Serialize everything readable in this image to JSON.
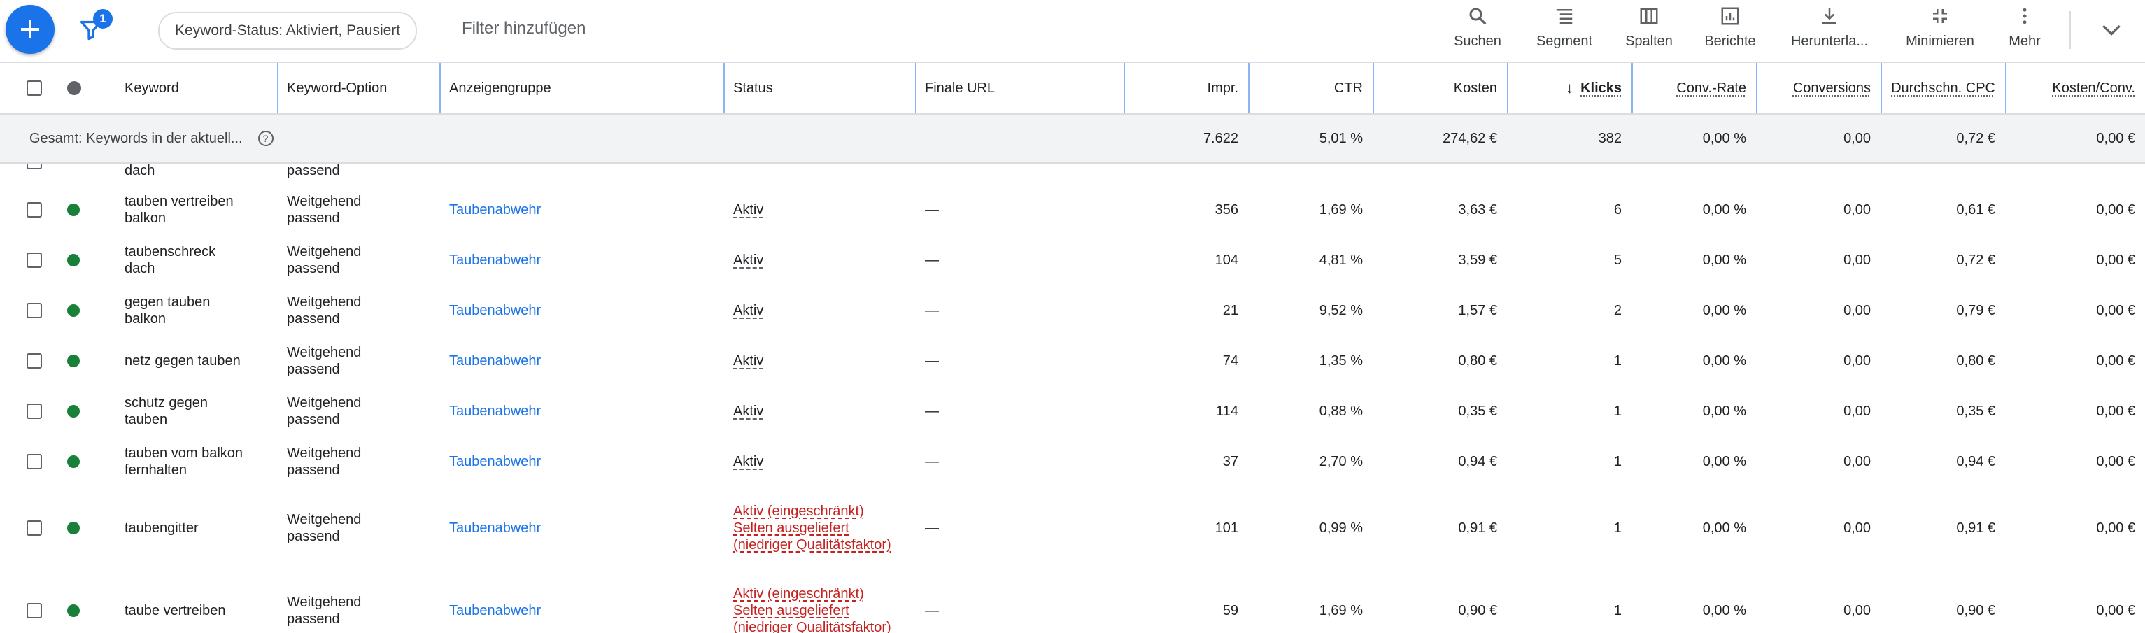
{
  "toolbar": {
    "filter_count": "1",
    "filter_chip": "Keyword-Status: Aktiviert, Pausiert",
    "add_filter": "Filter hinzufügen",
    "tools": [
      {
        "label": "Suchen",
        "icon": "search-icon"
      },
      {
        "label": "Segment",
        "icon": "segment-icon"
      },
      {
        "label": "Spalten",
        "icon": "columns-icon"
      },
      {
        "label": "Berichte",
        "icon": "reports-icon"
      },
      {
        "label": "Herunterla...",
        "icon": "download-icon"
      },
      {
        "label": "Minimieren",
        "icon": "collapse-icon"
      },
      {
        "label": "Mehr",
        "icon": "more-vert-icon"
      }
    ]
  },
  "table": {
    "headers": {
      "keyword": "Keyword",
      "option": "Keyword-Option",
      "adgroup": "Anzeigengruppe",
      "status": "Status",
      "url": "Finale URL",
      "impr": "Impr.",
      "ctr": "CTR",
      "cost": "Kosten",
      "clicks": "Klicks",
      "convrate": "Conv.-Rate",
      "conversions": "Conversions",
      "cpc": "Durchschn. CPC",
      "costconv": "Kosten/Conv."
    },
    "total": {
      "label": "Gesamt: Keywords in der aktuell...",
      "impr": "7.622",
      "ctr": "5,01 %",
      "cost": "274,62 €",
      "clicks": "382",
      "convrate": "0,00 %",
      "conversions": "0,00",
      "cpc": "0,72 €",
      "costconv": "0,00 €"
    },
    "partial_row": {
      "keyword": "dach",
      "option": "passend"
    },
    "rows": [
      {
        "keyword": [
          "tauben vertreiben",
          "balkon"
        ],
        "option": [
          "Weitgehend",
          "passend"
        ],
        "adgroup": "Taubenabwehr",
        "status": [
          "Aktiv"
        ],
        "url": "—",
        "impr": "356",
        "ctr": "1,69 %",
        "cost": "3,63 €",
        "clicks": "6",
        "convrate": "0,00 %",
        "conversions": "0,00",
        "cpc": "0,61 €",
        "costconv": "0,00 €"
      },
      {
        "keyword": [
          "taubenschreck",
          "dach"
        ],
        "option": [
          "Weitgehend",
          "passend"
        ],
        "adgroup": "Taubenabwehr",
        "status": [
          "Aktiv"
        ],
        "url": "—",
        "impr": "104",
        "ctr": "4,81 %",
        "cost": "3,59 €",
        "clicks": "5",
        "convrate": "0,00 %",
        "conversions": "0,00",
        "cpc": "0,72 €",
        "costconv": "0,00 €"
      },
      {
        "keyword": [
          "gegen tauben",
          "balkon"
        ],
        "option": [
          "Weitgehend",
          "passend"
        ],
        "adgroup": "Taubenabwehr",
        "status": [
          "Aktiv"
        ],
        "url": "—",
        "impr": "21",
        "ctr": "9,52 %",
        "cost": "1,57 €",
        "clicks": "2",
        "convrate": "0,00 %",
        "conversions": "0,00",
        "cpc": "0,79 €",
        "costconv": "0,00 €"
      },
      {
        "keyword": [
          "netz gegen tauben"
        ],
        "option": [
          "Weitgehend",
          "passend"
        ],
        "adgroup": "Taubenabwehr",
        "status": [
          "Aktiv"
        ],
        "url": "—",
        "impr": "74",
        "ctr": "1,35 %",
        "cost": "0,80 €",
        "clicks": "1",
        "convrate": "0,00 %",
        "conversions": "0,00",
        "cpc": "0,80 €",
        "costconv": "0,00 €"
      },
      {
        "keyword": [
          "schutz gegen",
          "tauben"
        ],
        "option": [
          "Weitgehend",
          "passend"
        ],
        "adgroup": "Taubenabwehr",
        "status": [
          "Aktiv"
        ],
        "url": "—",
        "impr": "114",
        "ctr": "0,88 %",
        "cost": "0,35 €",
        "clicks": "1",
        "convrate": "0,00 %",
        "conversions": "0,00",
        "cpc": "0,35 €",
        "costconv": "0,00 €"
      },
      {
        "keyword": [
          "tauben vom balkon",
          "fernhalten"
        ],
        "option": [
          "Weitgehend",
          "passend"
        ],
        "adgroup": "Taubenabwehr",
        "status": [
          "Aktiv"
        ],
        "url": "—",
        "impr": "37",
        "ctr": "2,70 %",
        "cost": "0,94 €",
        "clicks": "1",
        "convrate": "0,00 %",
        "conversions": "0,00",
        "cpc": "0,94 €",
        "costconv": "0,00 €"
      },
      {
        "keyword": [
          "taubengitter"
        ],
        "option": [
          "Weitgehend",
          "passend"
        ],
        "adgroup": "Taubenabwehr",
        "status": [
          "Aktiv (eingeschränkt)",
          "Selten ausgeliefert",
          "(niedriger Qualitätsfaktor)"
        ],
        "url": "—",
        "impr": "101",
        "ctr": "0,99 %",
        "cost": "0,91 €",
        "clicks": "1",
        "convrate": "0,00 %",
        "conversions": "0,00",
        "cpc": "0,91 €",
        "costconv": "0,00 €"
      },
      {
        "keyword": [
          "taube vertreiben"
        ],
        "option": [
          "Weitgehend",
          "passend"
        ],
        "adgroup": "Taubenabwehr",
        "status": [
          "Aktiv (eingeschränkt)",
          "Selten ausgeliefert",
          "(niedriger Qualitätsfaktor)"
        ],
        "url": "—",
        "impr": "59",
        "ctr": "1,69 %",
        "cost": "0,90 €",
        "clicks": "1",
        "convrate": "0,00 %",
        "conversions": "0,00",
        "cpc": "0,90 €",
        "costconv": "0,00 €"
      }
    ]
  },
  "colors": {
    "accent": "#1a73e8",
    "status_active": "#188038",
    "limited": "#c5221f"
  }
}
